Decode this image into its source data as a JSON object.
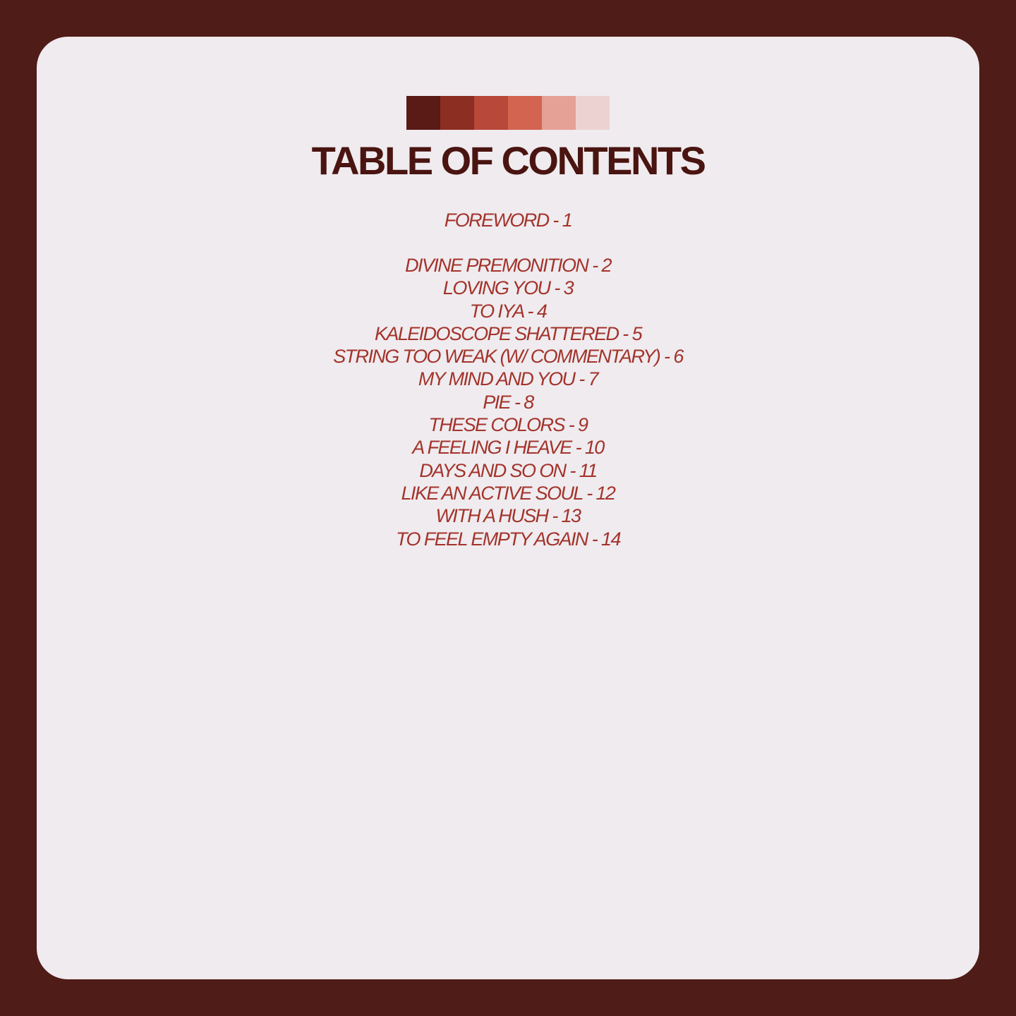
{
  "palette": {
    "swatches": [
      "#5a1a16",
      "#8c2e22",
      "#b8483a",
      "#d26450",
      "#e6a196",
      "#ecd3d1"
    ]
  },
  "colors": {
    "background": "#4f1c18",
    "card": "#efebef",
    "title": "#4a1410",
    "entries": "#a3332a"
  },
  "title": "TABLE OF CONTENTS",
  "foreword": "FOREWORD - 1",
  "entries": [
    "DIVINE PREMONITION - 2",
    "LOVING YOU - 3",
    "TO IYA - 4",
    "KALEIDOSCOPE SHATTERED - 5",
    "STRING TOO WEAK (W/ COMMENTARY) - 6",
    "MY MIND AND YOU - 7",
    "PIE - 8",
    "THESE COLORS - 9",
    "A FEELING I HEAVE - 10",
    "DAYS AND SO ON - 11",
    "LIKE AN ACTIVE SOUL - 12",
    "WITH A HUSH - 13",
    "TO FEEL EMPTY AGAIN - 14"
  ]
}
